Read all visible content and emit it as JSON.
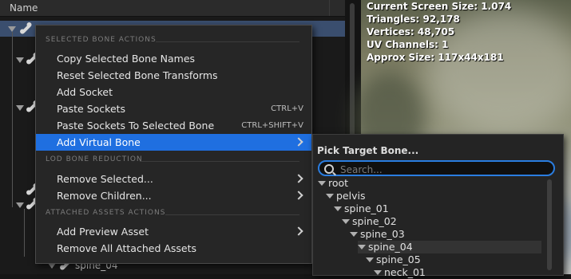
{
  "tree": {
    "header_label": "Name",
    "visible_bone_label": "spine_04"
  },
  "viewport": {
    "stats": [
      "Current Screen Size: 1.074",
      "Triangles: 92,178",
      "Vertices: 48,705",
      "UV Channels: 1",
      "Approx Size: 117x44x181"
    ]
  },
  "context_menu": {
    "sections": [
      {
        "header": "SELECTED BONE ACTIONS",
        "items": [
          {
            "label": "Copy Selected Bone Names",
            "shortcut": ""
          },
          {
            "label": "Reset Selected Bone Transforms",
            "shortcut": ""
          },
          {
            "label": "Add Socket",
            "shortcut": ""
          },
          {
            "label": "Paste Sockets",
            "shortcut": "CTRL+V"
          },
          {
            "label": "Paste Sockets To Selected Bone",
            "shortcut": "CTRL+SHIFT+V"
          },
          {
            "label": "Add Virtual Bone",
            "shortcut": "",
            "submenu": true,
            "highlighted": true
          }
        ]
      },
      {
        "header": "LOD BONE REDUCTION",
        "items": [
          {
            "label": "Remove Selected...",
            "submenu": true
          },
          {
            "label": "Remove Children...",
            "submenu": true
          }
        ]
      },
      {
        "header": "ATTACHED ASSETS ACTIONS",
        "items": [
          {
            "label": "Add Preview Asset",
            "submenu": true
          },
          {
            "label": "Remove All Attached Assets"
          }
        ]
      }
    ]
  },
  "bone_picker": {
    "title": "Pick Target Bone...",
    "search_placeholder": "Search...",
    "search_value": "",
    "bones": [
      "root",
      "pelvis",
      "spine_01",
      "spine_02",
      "spine_03",
      "spine_04",
      "spine_05",
      "neck_01"
    ],
    "hovered_bone": "spine_04"
  },
  "colors": {
    "highlight": "#1f6fe0",
    "search_focus": "#2a7de0",
    "selected_row": "#3a4e6e"
  }
}
